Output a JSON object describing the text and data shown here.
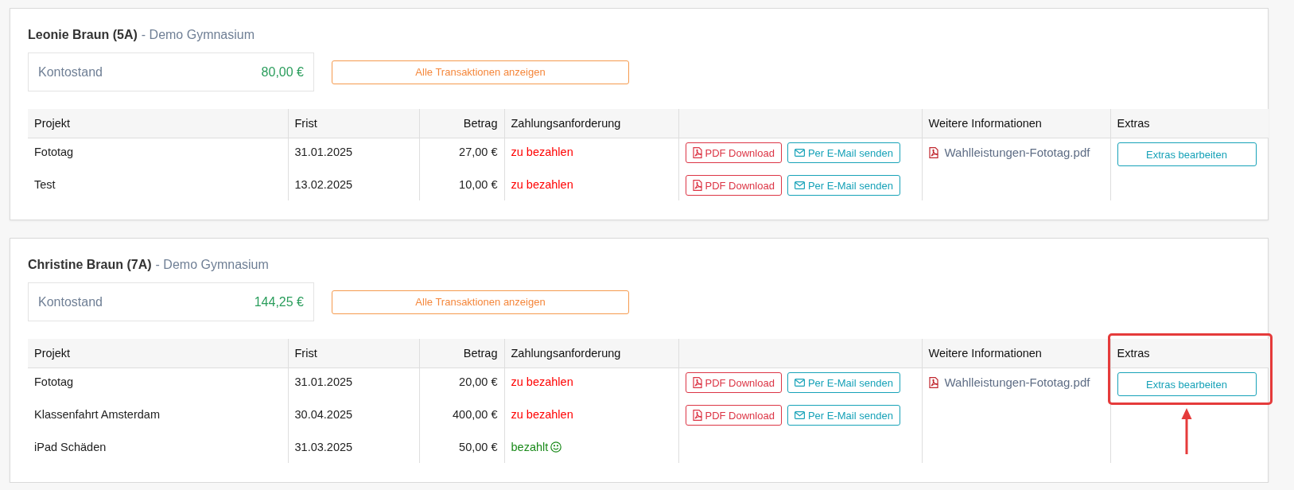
{
  "students": [
    {
      "name": "Leonie Braun (5A)",
      "school": "- Demo Gymnasium",
      "balance_label": "Kontostand",
      "balance": "80,00 €",
      "transactions_button": "Alle Transaktionen anzeigen",
      "columns": {
        "project": "Projekt",
        "deadline": "Frist",
        "amount": "Betrag",
        "request": "Zahlungsanforderung",
        "info": "Weitere Informationen",
        "extras": "Extras"
      },
      "rows": [
        {
          "project": "Fototag",
          "deadline": "31.01.2025",
          "amount": "27,00 €",
          "status": {
            "kind": "due",
            "label": "zu bezahlen"
          },
          "actions": [
            {
              "kind": "pdf",
              "label": "PDF Download"
            },
            {
              "kind": "email",
              "label": "Per E-Mail senden"
            }
          ]
        },
        {
          "project": "Test",
          "deadline": "13.02.2025",
          "amount": "10,00 €",
          "status": {
            "kind": "due",
            "label": "zu bezahlen"
          },
          "actions": [
            {
              "kind": "pdf",
              "label": "PDF Download"
            },
            {
              "kind": "email",
              "label": "Per E-Mail senden"
            }
          ]
        }
      ],
      "info_link": "Wahlleistungen-Fototag.pdf",
      "extras_button": "Extras bearbeiten",
      "highlighted": false
    },
    {
      "name": "Christine Braun (7A)",
      "school": "- Demo Gymnasium",
      "balance_label": "Kontostand",
      "balance": "144,25 €",
      "transactions_button": "Alle Transaktionen anzeigen",
      "columns": {
        "project": "Projekt",
        "deadline": "Frist",
        "amount": "Betrag",
        "request": "Zahlungsanforderung",
        "info": "Weitere Informationen",
        "extras": "Extras"
      },
      "rows": [
        {
          "project": "Fototag",
          "deadline": "31.01.2025",
          "amount": "20,00 €",
          "status": {
            "kind": "due",
            "label": "zu bezahlen"
          },
          "actions": [
            {
              "kind": "pdf",
              "label": "PDF Download"
            },
            {
              "kind": "email",
              "label": "Per E-Mail senden"
            }
          ]
        },
        {
          "project": "Klassenfahrt Amsterdam",
          "deadline": "30.04.2025",
          "amount": "400,00 €",
          "status": {
            "kind": "due",
            "label": "zu bezahlen"
          },
          "actions": [
            {
              "kind": "pdf",
              "label": "PDF Download"
            },
            {
              "kind": "email",
              "label": "Per E-Mail senden"
            }
          ]
        },
        {
          "project": "iPad Schäden",
          "deadline": "31.03.2025",
          "amount": "50,00 €",
          "status": {
            "kind": "paid",
            "label": "bezahlt"
          },
          "actions": []
        }
      ],
      "info_link": "Wahlleistungen-Fototag.pdf",
      "extras_button": "Extras bearbeiten",
      "highlighted": true
    }
  ]
}
